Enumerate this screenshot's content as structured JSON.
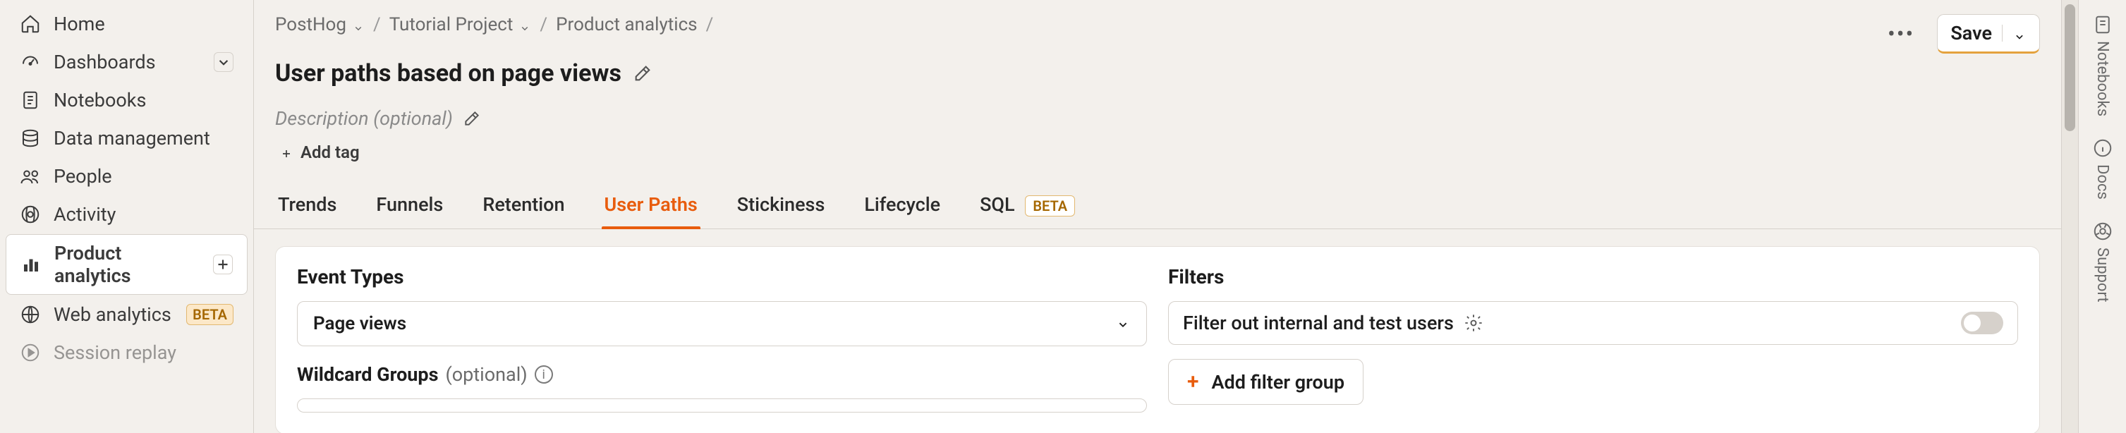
{
  "sidebar": {
    "items": [
      {
        "id": "home",
        "label": "Home",
        "icon": "home-icon"
      },
      {
        "id": "dashboards",
        "label": "Dashboards",
        "icon": "gauge-icon",
        "has_chevron": true
      },
      {
        "id": "notebooks",
        "label": "Notebooks",
        "icon": "notebook-icon"
      },
      {
        "id": "data-mgmt",
        "label": "Data management",
        "icon": "database-icon"
      },
      {
        "id": "people",
        "label": "People",
        "icon": "people-icon"
      },
      {
        "id": "activity",
        "label": "Activity",
        "icon": "activity-icon"
      },
      {
        "id": "product-analytics",
        "label": "Product analytics",
        "icon": "bar-chart-icon",
        "has_plus": true,
        "active": true
      },
      {
        "id": "web-analytics",
        "label": "Web analytics",
        "icon": "globe-icon",
        "badge": "BETA"
      },
      {
        "id": "session-replay",
        "label": "Session replay",
        "icon": "play-icon",
        "faded": true
      }
    ]
  },
  "breadcrumbs": [
    {
      "label": "PostHog"
    },
    {
      "label": "Tutorial Project"
    },
    {
      "label": "Product analytics"
    }
  ],
  "page_title": "User paths based on page views",
  "description_placeholder": "Description (optional)",
  "add_tag_label": "Add tag",
  "header_actions": {
    "more": "•••",
    "save_label": "Save"
  },
  "tabs": [
    {
      "id": "trends",
      "label": "Trends"
    },
    {
      "id": "funnels",
      "label": "Funnels"
    },
    {
      "id": "retention",
      "label": "Retention"
    },
    {
      "id": "user-paths",
      "label": "User Paths",
      "active": true
    },
    {
      "id": "stickiness",
      "label": "Stickiness"
    },
    {
      "id": "lifecycle",
      "label": "Lifecycle"
    },
    {
      "id": "sql",
      "label": "SQL",
      "badge": "BETA"
    }
  ],
  "panel": {
    "event_types_title": "Event Types",
    "event_types_value": "Page views",
    "wildcard_label": "Wildcard Groups",
    "wildcard_optional": "(optional)",
    "filters_title": "Filters",
    "filter_internal_label": "Filter out internal and test users",
    "add_filter_group_label": "Add filter group"
  },
  "right_rail": [
    {
      "id": "notebooks",
      "label": "Notebooks",
      "icon": "notebook-icon"
    },
    {
      "id": "docs",
      "label": "Docs",
      "icon": "info-icon"
    },
    {
      "id": "support",
      "label": "Support",
      "icon": "support-icon"
    }
  ]
}
